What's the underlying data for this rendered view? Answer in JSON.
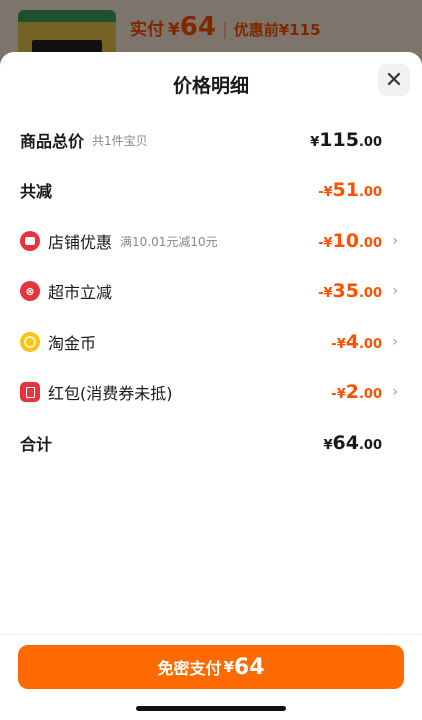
{
  "background": {
    "paid_label": "实付",
    "paid_symbol": "¥",
    "paid_value": "64",
    "separator": "|",
    "original_label": "优惠前",
    "original_value": "¥115"
  },
  "sheet": {
    "title": "价格明细",
    "close_icon": "close-icon"
  },
  "rows": {
    "total": {
      "label": "商品总价",
      "sub": "共1件宝贝",
      "yen": "¥",
      "int": "115",
      "dec": ".00"
    },
    "reduced": {
      "label": "共减",
      "sign": "-",
      "yen": "¥",
      "int": "51",
      "dec": ".00"
    },
    "store": {
      "label": "店铺优惠",
      "sub": "满10.01元减10元",
      "sign": "-",
      "yen": "¥",
      "int": "10",
      "dec": ".00",
      "icon": "store-coupon-icon"
    },
    "market": {
      "label": "超市立减",
      "sign": "-",
      "yen": "¥",
      "int": "35",
      "dec": ".00",
      "icon": "supermarket-discount-icon"
    },
    "coin": {
      "label": "淘金币",
      "sign": "-",
      "yen": "¥",
      "int": "4",
      "dec": ".00",
      "icon": "gold-coin-icon"
    },
    "redpack": {
      "label": "红包(消费券未抵)",
      "sign": "-",
      "yen": "¥",
      "int": "2",
      "dec": ".00",
      "icon": "red-packet-icon"
    },
    "sum": {
      "label": "合计",
      "yen": "¥",
      "int": "64",
      "dec": ".00"
    }
  },
  "pay_button": {
    "label": "免密支付",
    "yen": "¥",
    "value": "64"
  },
  "colors": {
    "accent": "#ff5000",
    "button": "#ff6a00",
    "icon_red": "#e8323c",
    "coin": "#f8c21c"
  }
}
